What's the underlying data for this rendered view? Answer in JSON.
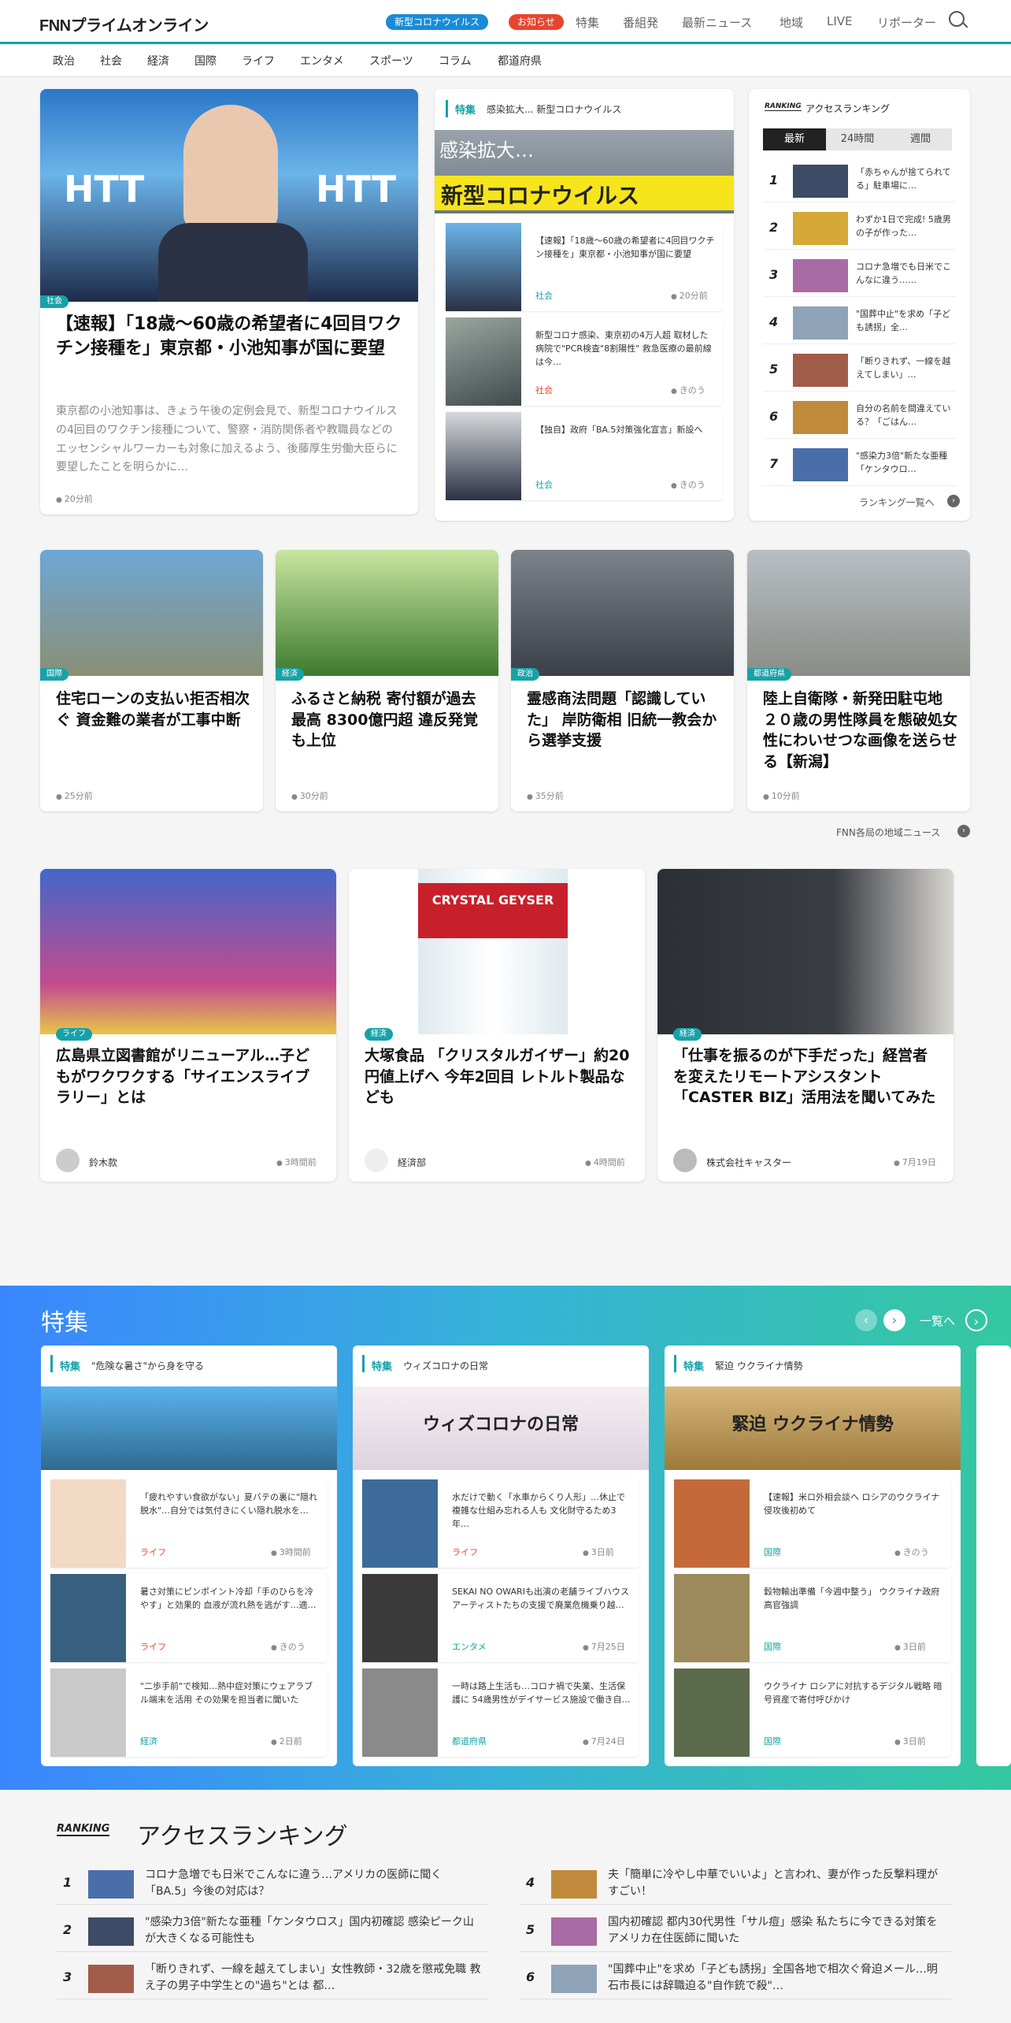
{
  "header": {
    "logo": "FNNプライムオンライン",
    "pill1": "新型コロナウイルス",
    "pill2": "お知らせ",
    "nav": [
      "特集",
      "番組発",
      "最新ニュース",
      "地域",
      "LIVE",
      "リポーター"
    ]
  },
  "categories": [
    "政治",
    "社会",
    "経済",
    "国際",
    "ライフ",
    "エンタメ",
    "スポーツ",
    "コラム",
    "都道府県"
  ],
  "top": {
    "tag": "社会",
    "title": "【速報】「18歳～60歳の希望者に4回目ワクチン接種を」東京都・小池知事が国に要望",
    "desc": "東京都の小池知事は、きょう午後の定例会見で、新型コロナウイルスの4回目のワクチン接種について、警察・消防関係者や教職員などのエッセンシャルワーカーも対象に加えるよう、後藤厚生労働大臣らに要望したことを明らかに…",
    "time": "20分前"
  },
  "feature_top": {
    "label": "特集",
    "title": "感染拡大... 新型コロナウイルス",
    "banner": "新型コロナウイルス",
    "banner_sub": "感染拡大…",
    "items": [
      {
        "title": "【速報】「18歳～60歳の希望者に4回目ワクチン接種を」東京都・小池知事が国に要望",
        "cat": "社会",
        "time": "20分前"
      },
      {
        "title": "新型コロナ感染、東京初の4万人超 取材した病院で\"PCR検査\"8割陽性\" 救急医療の最前線は今…",
        "cat": "社会",
        "time": "きのう"
      },
      {
        "title": "【独自】政府「BA.5対策強化宣言」新設へ",
        "cat": "社会",
        "time": "きのう"
      }
    ]
  },
  "ranking": {
    "title": "アクセスランキング",
    "tabs": [
      "最新",
      "24時間",
      "週間"
    ],
    "items": [
      {
        "n": "1",
        "t": "「赤ちゃんが捨てられてる」駐車場に…"
      },
      {
        "n": "2",
        "t": "わずか1日で完成! 5歳男の子が作った…"
      },
      {
        "n": "3",
        "t": "コロナ急増でも日米でこんなに違う……"
      },
      {
        "n": "4",
        "t": "\"国葬中止\"を求め「子ども誘拐」全…"
      },
      {
        "n": "5",
        "t": "「断りきれず、一線を越えてしまい」…"
      },
      {
        "n": "6",
        "t": "自分の名前を間違えている？「ごはん…"
      },
      {
        "n": "7",
        "t": "\"感染力3倍\"新たな亜種「ケンタウロ…"
      }
    ],
    "more": "ランキング一覧へ"
  },
  "row2": [
    {
      "tag": "国際",
      "title": "住宅ローンの支払い拒否相次ぐ 資金難の業者が工事中断",
      "time": "25分前"
    },
    {
      "tag": "経済",
      "title": "ふるさと納税 寄付額が過去最高 8300億円超 違反発覚も上位",
      "time": "30分前"
    },
    {
      "tag": "政治",
      "title": "霊感商法問題「認識していた」 岸防衛相 旧統一教会から選挙支援",
      "time": "35分前"
    },
    {
      "tag": "都道府県",
      "title": "陸上自衛隊・新発田駐屯地 ２０歳の男性隊員を態破処女性にわいせつな画像を送らせる【新潟】",
      "time": "10分前"
    }
  ],
  "local_link": "FNN各局の地域ニュース",
  "row3": [
    {
      "tag": "ライフ",
      "title": "広島県立図書館がリニューアル…子どもがワクワクする「サイエンスライブラリー」とは",
      "author": "鈴木款",
      "time": "3時間前"
    },
    {
      "tag": "経済",
      "title": "大塚食品 「クリスタルガイザー」約20円値上げへ 今年2回目 レトルト製品なども",
      "author": "経済部",
      "time": "4時間前",
      "bottle": "CRYSTAL GEYSER"
    },
    {
      "tag": "経済",
      "title": "「仕事を振るのが下手だった」経営者を変えたリモートアシスタント「CASTER BIZ」活用法を聞いてみた",
      "author": "株式会社キャスター",
      "time": "7月19日"
    }
  ],
  "features": {
    "title": "特集",
    "more": "一覧へ",
    "cards": [
      {
        "label": "特集",
        "name": "\"危険な暑さ\"から身を守る",
        "banner": "",
        "items": [
          {
            "t": "「疲れやすい食欲がない」夏バテの裏に\"隠れ脱水\"…自分では気付きにくい隠れ脱水を…",
            "c": "ライフ",
            "time": "3時間前"
          },
          {
            "t": "暑さ対策にピンポイント冷却「手のひらを冷やす」と効果的 血液が流れ熱を逃がす…適…",
            "c": "ライフ",
            "time": "きのう"
          },
          {
            "t": "\"二歩手前\"で検知…熱中症対策にウェアラブル端末を活用 その効果を担当者に聞いた",
            "c": "経済",
            "time": "2日前"
          }
        ]
      },
      {
        "label": "特集",
        "name": "ウィズコロナの日常",
        "banner": "ウィズコロナの日常",
        "items": [
          {
            "t": "水だけで動く「水車からくり人形」…休止で複雑な仕組み忘れる人も 文化財守るため3年…",
            "c": "ライフ",
            "time": "3日前"
          },
          {
            "t": "SEKAI NO OWARIも出演の老舗ライブハウス アーティストたちの支援で廃業危機乗り越…",
            "c": "エンタメ",
            "time": "7月25日"
          },
          {
            "t": "一時は路上生活も…コロナ禍で失業、生活保護に 54歳男性がデイサービス施設で働き自…",
            "c": "都道府県",
            "time": "7月24日"
          }
        ]
      },
      {
        "label": "特集",
        "name": "緊迫 ウクライナ情勢",
        "banner": "緊迫 ウクライナ情勢",
        "items": [
          {
            "t": "【速報】米ロ外相会談へ ロシアのウクライナ侵攻後初めて",
            "c": "国際",
            "time": "きのう"
          },
          {
            "t": "穀物輸出準備「今週中整う」 ウクライナ政府高官強調",
            "c": "国際",
            "time": "3日前"
          },
          {
            "t": "ウクライナ ロシアに対抗するデジタル戦略 暗号資産で寄付呼びかけ",
            "c": "国際",
            "time": "3日前"
          }
        ]
      }
    ]
  },
  "ranking_bottom": {
    "logo": "RANKING",
    "title": "アクセスランキング",
    "items": [
      {
        "n": "1",
        "t": "コロナ急増でも日米でこんなに違う…アメリカの医師に聞く「BA.5」今後の対応は？"
      },
      {
        "n": "4",
        "t": "夫「簡単に冷やし中華でいいよ」と言われ、妻が作った反撃料理がすごい！"
      },
      {
        "n": "2",
        "t": "\"感染力3倍\"新たな亜種「ケンタウロス」国内初確認 感染ピーク山が大きくなる可能性も"
      },
      {
        "n": "5",
        "t": "国内初確認 都内30代男性「サル痘」感染 私たちに今できる対策をアメリカ在住医師に聞いた"
      },
      {
        "n": "3",
        "t": "「断りきれず、一線を越えてしまい」女性教師・32歳を懲戒免職 教え子の男子中学生との\"過ち\"とは 都…"
      },
      {
        "n": "6",
        "t": "\"国葬中止\"を求め「子ども誘拐」全国各地で相次ぐ脅迫メール…明石市長には辞職迫る\"自作銃で殺\"…"
      }
    ]
  },
  "colors": {
    "accent": "#17a2a8",
    "pill_blue": "#1a8bd6",
    "pill_red": "#e8452c"
  }
}
